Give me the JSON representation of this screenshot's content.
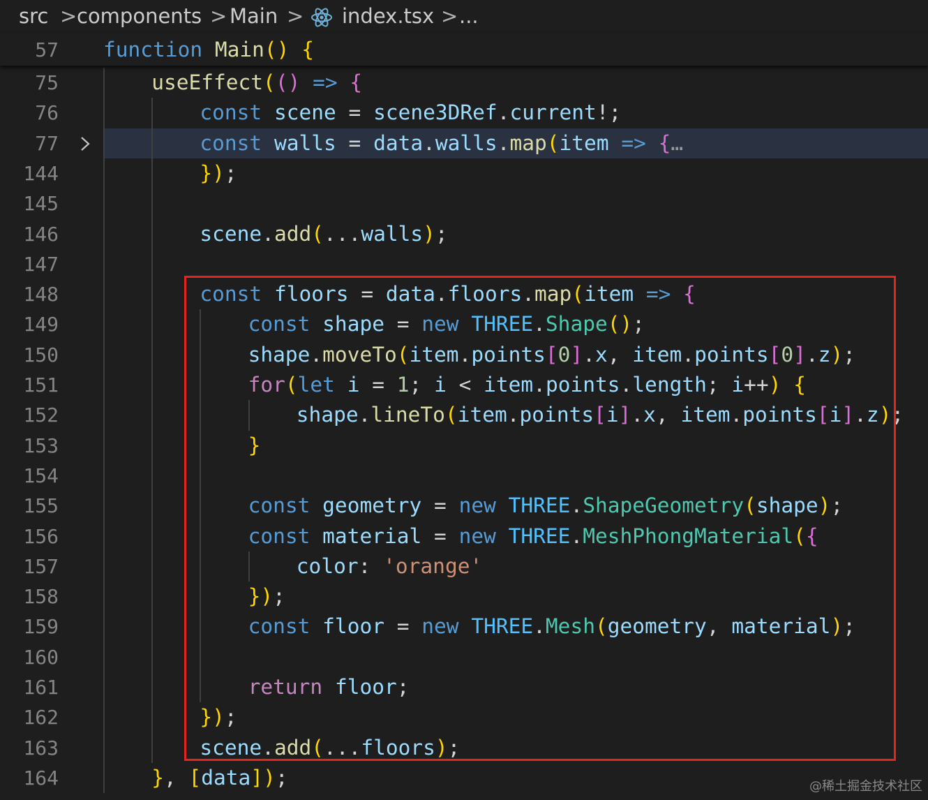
{
  "breadcrumb": {
    "items": [
      "src",
      "components",
      "Main",
      "index.tsx",
      "..."
    ],
    "separator": ">"
  },
  "sticky": {
    "line_number": "57",
    "text": "function Main() {"
  },
  "code_lines": [
    {
      "n": "75",
      "text": "useEffect(() => {"
    },
    {
      "n": "76",
      "text": "const scene = scene3DRef.current!;"
    },
    {
      "n": "77",
      "text": "const walls = data.walls.map(item => {…",
      "folded": true
    },
    {
      "n": "144",
      "text": "});"
    },
    {
      "n": "145",
      "text": ""
    },
    {
      "n": "146",
      "text": "scene.add(...walls);"
    },
    {
      "n": "147",
      "text": ""
    },
    {
      "n": "148",
      "text": "const floors = data.floors.map(item => {"
    },
    {
      "n": "149",
      "text": "const shape = new THREE.Shape();"
    },
    {
      "n": "150",
      "text": "shape.moveTo(item.points[0].x, item.points[0].z);"
    },
    {
      "n": "151",
      "text": "for(let i = 1; i < item.points.length; i++) {"
    },
    {
      "n": "152",
      "text": "shape.lineTo(item.points[i].x, item.points[i].z);"
    },
    {
      "n": "153",
      "text": "}"
    },
    {
      "n": "154",
      "text": ""
    },
    {
      "n": "155",
      "text": "const geometry = new THREE.ShapeGeometry(shape);"
    },
    {
      "n": "156",
      "text": "const material = new THREE.MeshPhongMaterial({"
    },
    {
      "n": "157",
      "text": "color: 'orange'"
    },
    {
      "n": "158",
      "text": "});"
    },
    {
      "n": "159",
      "text": "const floor = new THREE.Mesh(geometry, material);"
    },
    {
      "n": "160",
      "text": ""
    },
    {
      "n": "161",
      "text": "return floor;"
    },
    {
      "n": "162",
      "text": "});"
    },
    {
      "n": "163",
      "text": "scene.add(...floors);"
    },
    {
      "n": "164",
      "text": "}, [data]);"
    }
  ],
  "fold_icon": "chevron-right-icon",
  "breadcrumb_file_icon": "react-icon",
  "highlight_box_color": "#e8231d",
  "watermark": "@稀土掘金技术社区"
}
